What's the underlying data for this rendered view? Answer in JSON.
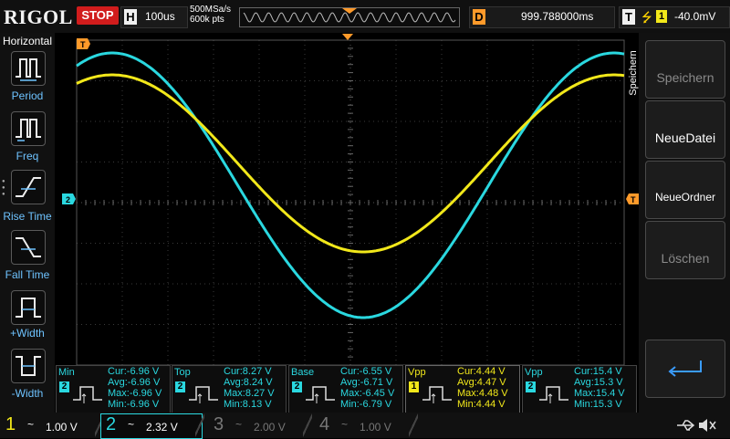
{
  "brand": "RIGOL",
  "run_state": "STOP",
  "timebase": {
    "letter": "H",
    "value": "100us"
  },
  "sample_rate": "500MSa/s",
  "memory_depth": "600k pts",
  "delay": {
    "letter": "D",
    "value": "999.788000ms"
  },
  "trigger": {
    "letter": "T",
    "source": "1",
    "level": "-40.0mV"
  },
  "left_menu": {
    "title": "Horizontal",
    "items": [
      {
        "label": "Period"
      },
      {
        "label": "Freq"
      },
      {
        "label": "Rise Time"
      },
      {
        "label": "Fall Time"
      },
      {
        "label": "+Width"
      },
      {
        "label": "-Width"
      }
    ]
  },
  "right_menu": {
    "title": "Speichern",
    "items": [
      {
        "label": "Speichern",
        "enabled": false
      },
      {
        "label": "NeueDatei",
        "enabled": true
      },
      {
        "label": "NeueOrdner",
        "enabled": true
      },
      {
        "label": "Löschen",
        "enabled": false
      },
      {
        "label": "enter-icon",
        "enabled": true
      }
    ]
  },
  "channel_markers": {
    "ch2": "2",
    "trigger": "T"
  },
  "measurements": [
    {
      "name": "Min",
      "channel": "2",
      "cur": "Cur:-6.96 V",
      "avg": "Avg:-6.96 V",
      "max": "Max:-6.96 V",
      "min": "Min:-6.96 V"
    },
    {
      "name": "Top",
      "channel": "2",
      "cur": "Cur:8.27 V",
      "avg": "Avg:8.24 V",
      "max": "Max:8.27 V",
      "min": "Min:8.13 V"
    },
    {
      "name": "Base",
      "channel": "2",
      "cur": "Cur:-6.55 V",
      "avg": "Avg:-6.71 V",
      "max": "Max:-6.45 V",
      "min": "Min:-6.79 V"
    },
    {
      "name": "Vpp",
      "channel": "1",
      "cur": "Cur:4.44 V",
      "avg": "Avg:4.47 V",
      "max": "Max:4.48 V",
      "min": "Min:4.44 V"
    },
    {
      "name": "Vpp",
      "channel": "2",
      "cur": "Cur:15.4 V",
      "avg": "Avg:15.3 V",
      "max": "Max:15.4 V",
      "min": "Min:15.3 V"
    }
  ],
  "channels": [
    {
      "num": "1",
      "coupling": "~",
      "scale": "1.00 V",
      "active": true
    },
    {
      "num": "2",
      "coupling": "~",
      "scale": "2.32 V",
      "active": true
    },
    {
      "num": "3",
      "coupling": "~",
      "scale": "2.00 V",
      "active": false
    },
    {
      "num": "4",
      "coupling": "~",
      "scale": "1.00 V",
      "active": false
    }
  ],
  "colors": {
    "ch1": "#f2e81a",
    "ch2": "#2ad8e0",
    "ch3": "#d15cd1",
    "ch4": "#3a7cff",
    "accent": "#ff9a2a",
    "stop": "#d11c1c",
    "label": "#6ec3ff"
  }
}
